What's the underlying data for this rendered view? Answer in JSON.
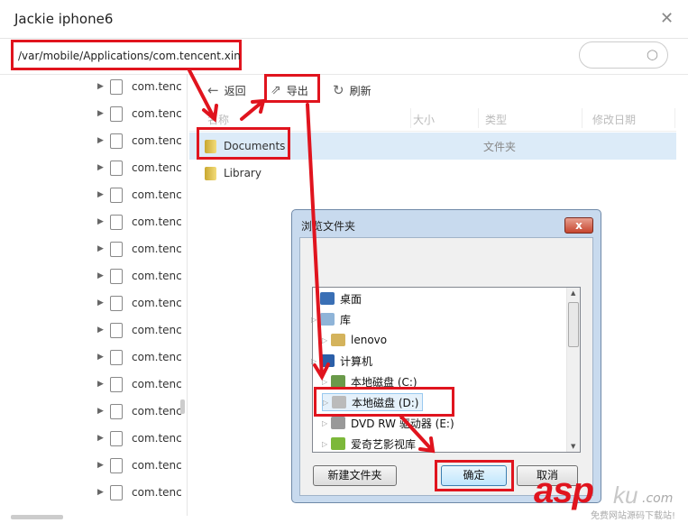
{
  "window": {
    "title": "Jackie iphone6"
  },
  "path_input": {
    "value": "/var/mobile/Applications/com.tencent.xin"
  },
  "tree": {
    "items": [
      "com.tenc",
      "com.tenc",
      "com.tenc",
      "com.tenc",
      "com.tenc",
      "com.tenc",
      "com.tenc",
      "com.tenc",
      "com.tenc",
      "com.tenc",
      "com.tenc",
      "com.tenc",
      "com.tenc",
      "com.tenc",
      "com.tenc",
      "com.tenc"
    ]
  },
  "toolbar": {
    "back": "返回",
    "export": "导出",
    "refresh": "刷新"
  },
  "columns": {
    "name": "名称",
    "size": "大小",
    "type": "类型",
    "modified": "修改日期"
  },
  "files": [
    {
      "name": "Documents",
      "type": "文件夹"
    },
    {
      "name": "Library",
      "type": ""
    }
  ],
  "dialog": {
    "title": "浏览文件夹",
    "items": [
      "桌面",
      "库",
      "lenovo",
      "计算机",
      "本地磁盘 (C:)",
      "本地磁盘 (D:)",
      "DVD RW 驱动器 (E:)",
      "爱奇艺影视库"
    ],
    "new_folder": "新建文件夹",
    "ok": "确定",
    "cancel": "取消"
  },
  "watermark": {
    "asp": "asp",
    "ku": "ku",
    ".com": ".com",
    "slogan": "免费网站源码下载站!"
  },
  "colors": {
    "annotation": "#e0141e",
    "selection": "#dcebf8"
  }
}
